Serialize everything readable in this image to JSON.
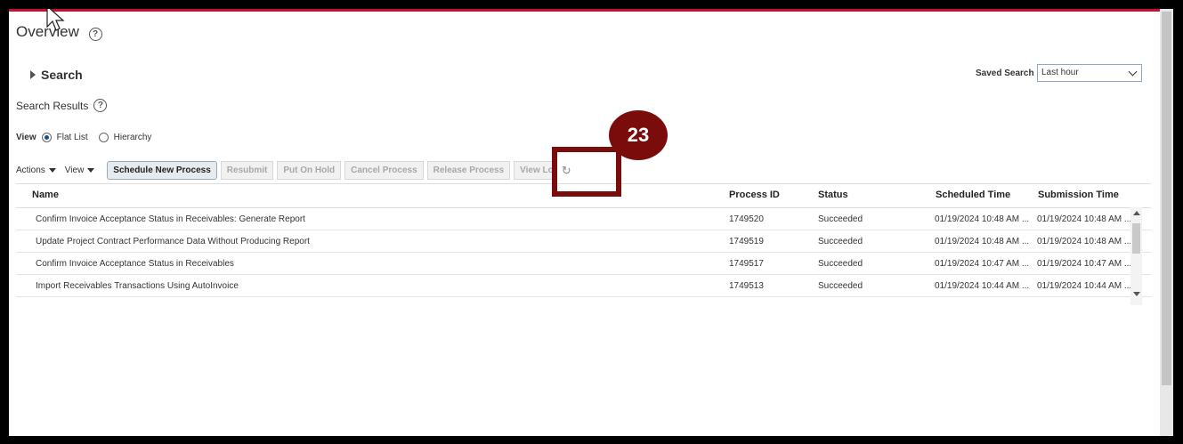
{
  "page": {
    "title": "Overview"
  },
  "search": {
    "label": "Search",
    "saved_label": "Saved Search",
    "saved_value": "Last hour"
  },
  "results": {
    "title": "Search Results"
  },
  "view": {
    "label": "View",
    "options": [
      "Flat List",
      "Hierarchy"
    ],
    "selected": "Flat List"
  },
  "toolbar": {
    "actions": "Actions",
    "view": "View",
    "buttons": [
      "Schedule New Process",
      "Resubmit",
      "Put On Hold",
      "Cancel Process",
      "Release Process",
      "View Log"
    ]
  },
  "table": {
    "headers": [
      "Name",
      "Process ID",
      "Status",
      "Scheduled Time",
      "Submission Time"
    ],
    "rows": [
      [
        "Confirm Invoice Acceptance Status in Receivables: Generate Report",
        "1749520",
        "Succeeded",
        "01/19/2024 10:48 AM ...",
        "01/19/2024 10:48 AM ..."
      ],
      [
        "Update Project Contract Performance Data Without Producing Report",
        "1749519",
        "Succeeded",
        "01/19/2024 10:48 AM ...",
        "01/19/2024 10:48 AM ..."
      ],
      [
        "Confirm Invoice Acceptance Status in Receivables",
        "1749517",
        "Succeeded",
        "01/19/2024 10:47 AM ...",
        "01/19/2024 10:47 AM ..."
      ],
      [
        "Import Receivables Transactions Using AutoInvoice",
        "1749513",
        "Succeeded",
        "01/19/2024 10:44 AM ...",
        "01/19/2024 10:44 AM ..."
      ]
    ]
  },
  "annotation": {
    "step": "23"
  },
  "icons": {
    "help": "help-circle-icon",
    "refresh": "refresh-icon"
  },
  "colors": {
    "accent_bar": "#c8102e",
    "annotation": "#7a0c0c"
  }
}
